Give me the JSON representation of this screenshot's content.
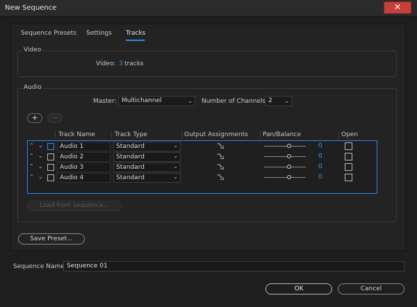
{
  "window": {
    "title": "New Sequence",
    "close_glyph": "✕"
  },
  "tabs": [
    {
      "label": "Sequence Presets",
      "active": false
    },
    {
      "label": "Settings",
      "active": false
    },
    {
      "label": "Tracks",
      "active": true
    }
  ],
  "video": {
    "group_label": "Video",
    "label": "Video:",
    "count": "3",
    "unit": "tracks"
  },
  "audio": {
    "group_label": "Audio",
    "master_label": "Master:",
    "master_value": "Multichannel",
    "channels_label": "Number of Channels:",
    "channels_value": "2",
    "add_button": "+",
    "remove_button": "−",
    "columns": [
      "Track Name",
      "Track Type",
      "Output Assignments",
      "Pan/Balance",
      "Open"
    ],
    "tracks": [
      {
        "name": "Audio 1",
        "type": "Standard",
        "pan": "0",
        "selected": true
      },
      {
        "name": "Audio 2",
        "type": "Standard",
        "pan": "0",
        "selected": false
      },
      {
        "name": "Audio 3",
        "type": "Standard",
        "pan": "0",
        "selected": false
      },
      {
        "name": "Audio 4",
        "type": "Standard",
        "pan": "0",
        "selected": false
      }
    ],
    "load_button": "Load from sequence..."
  },
  "save_preset_button": "Save Preset...",
  "sequence_name": {
    "label": "Sequence Name:",
    "value": "Sequence 01"
  },
  "ok_button": "OK",
  "cancel_button": "Cancel",
  "colors": {
    "accent": "#2d8ceb",
    "link": "#3d9be9",
    "close": "#c5403b"
  },
  "icons": {
    "up": "chevron-up-icon",
    "down": "chevron-down-icon",
    "output": "output-assignment-icon"
  }
}
